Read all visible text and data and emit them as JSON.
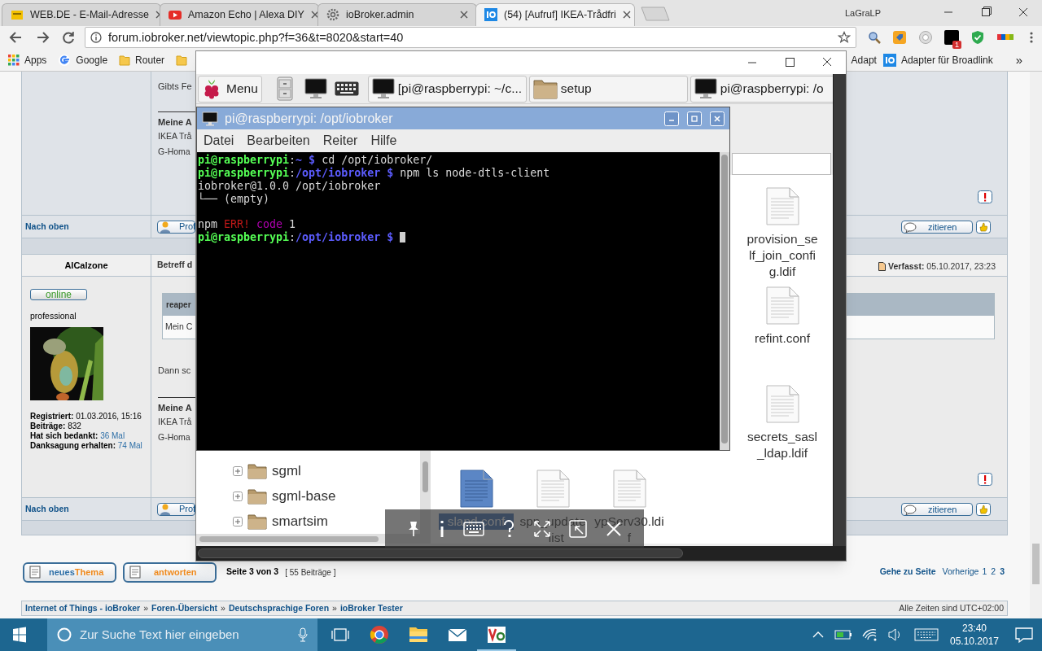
{
  "browser": {
    "tabs": [
      {
        "title": "WEB.DE - E-Mail-Adresse",
        "selected": false
      },
      {
        "title": "Amazon Echo | Alexa DIY",
        "selected": false
      },
      {
        "title": "ioBroker.admin",
        "selected": false
      },
      {
        "title": "(54) [Aufruf] IKEA-Trådfri",
        "selected": true
      }
    ],
    "profile": "LaGraLP",
    "url": "forum.iobroker.net/viewtopic.php?f=36&t=8020&start=40",
    "extension_badge": "1",
    "bookmarks_left": [
      {
        "kind": "apps",
        "label": "Apps"
      },
      {
        "kind": "site",
        "label": "Google"
      },
      {
        "kind": "folder",
        "label": "Router"
      }
    ],
    "bookmarks_right": [
      {
        "kind": "plain",
        "label": "Adapt"
      },
      {
        "kind": "site",
        "label": "Adapter für Broadlink"
      }
    ],
    "bookmarks_more": "»"
  },
  "forum": {
    "post_1": {
      "body": "Gibts Fe",
      "signature_title": "Meine A",
      "signature_lines": [
        "IKEA Trå",
        "G-Homa"
      ],
      "top_link": "Nach oben",
      "profile_button": "Prof",
      "quote_button": "zitieren"
    },
    "post_2": {
      "author": "AlCalzone",
      "subject": "Betreff d",
      "posted": "**Verfasst:** 05.10.2017, 23:23",
      "status": "online",
      "rank": "professional",
      "avatar": {
        "kind": "picture"
      },
      "stats": [
        {
          "label": "Registriert:",
          "value": "01.03.2016, 15:16",
          "link": false
        },
        {
          "label": "Beiträge:",
          "value": "832",
          "link": false
        },
        {
          "label": "Hat sich bedankt:",
          "value": "36 Mal",
          "link": true
        },
        {
          "label": "Danksagung erhalten:",
          "value": "74 Mal",
          "link": true
        }
      ],
      "quote": {
        "author": "reaper",
        "text": "Mein C"
      },
      "body": "Dann sc",
      "signature_title": "Meine A",
      "signature_lines": [
        "IKEA Trå",
        "G-Homa"
      ],
      "top_link": "Nach oben",
      "profile_button": "Prof",
      "quote_button": "zitieren"
    },
    "new_topic": [
      "neues",
      "Thema"
    ],
    "reply": "antworten",
    "page_info": "Seite 3 von 3",
    "post_count": "[ 55 Beiträge ]",
    "goto": "Gehe zu Seite",
    "previous": "Vorherige",
    "pages": [
      {
        "label": "1",
        "selected": false
      },
      {
        "label": "2",
        "selected": false
      },
      {
        "label": "3",
        "selected": true
      }
    ],
    "breadcrumb": [
      {
        "kind": "link",
        "text": "Internet of Things - ioBroker"
      },
      {
        "kind": "sep",
        "text": "»"
      },
      {
        "kind": "link",
        "text": "Foren-Übersicht"
      },
      {
        "kind": "sep",
        "text": "»"
      },
      {
        "kind": "link",
        "text": "Deutschsprachige Foren"
      },
      {
        "kind": "sep",
        "text": "»"
      },
      {
        "kind": "link",
        "text": "ioBroker Tester"
      }
    ],
    "timezone": "Alle Zeiten sind UTC+02:00"
  },
  "vnc": {
    "taskbar": {
      "menu": "Menu",
      "tasks": [
        {
          "kind": "terminal",
          "title": "[pi@raspberrypi: ~/c..."
        },
        {
          "kind": "folder",
          "title": "setup"
        },
        {
          "kind": "terminal",
          "title": "pi@raspberrypi: /o"
        }
      ]
    },
    "terminal": {
      "title": "pi@raspberrypi: /opt/iobroker",
      "menu": [
        "Datei",
        "Bearbeiten",
        "Reiter",
        "Hilfe"
      ],
      "lines": [
        {
          "gap_before": false,
          "cursor": false,
          "segments": [
            {
              "kind": "user",
              "text": "pi@raspberrypi"
            },
            {
              "kind": "text",
              "text": ":"
            },
            {
              "kind": "path",
              "text": "~ $"
            },
            {
              "kind": "text",
              "text": " cd /opt/iobroker/"
            }
          ]
        },
        {
          "gap_before": false,
          "cursor": false,
          "segments": [
            {
              "kind": "user",
              "text": "pi@raspberrypi"
            },
            {
              "kind": "text",
              "text": ":"
            },
            {
              "kind": "path",
              "text": "/opt/iobroker $"
            },
            {
              "kind": "text",
              "text": " npm ls node-dtls-client"
            }
          ]
        },
        {
          "gap_before": false,
          "cursor": false,
          "segments": [
            {
              "kind": "text",
              "text": "iobroker@1.0.0 /opt/iobroker"
            }
          ]
        },
        {
          "gap_before": false,
          "cursor": false,
          "segments": [
            {
              "kind": "text",
              "text": "└── (empty)"
            }
          ]
        },
        {
          "gap_before": true,
          "cursor": false,
          "segments": [
            {
              "kind": "text",
              "text": "npm "
            },
            {
              "kind": "error",
              "text": "ERR!"
            },
            {
              "kind": "warn",
              "text": " code"
            },
            {
              "kind": "text",
              "text": " 1"
            }
          ]
        },
        {
          "gap_before": false,
          "cursor": true,
          "segments": [
            {
              "kind": "user",
              "text": "pi@raspberrypi"
            },
            {
              "kind": "text",
              "text": ":"
            },
            {
              "kind": "path",
              "text": "/opt/iobroker $"
            }
          ]
        }
      ]
    },
    "file_manager": {
      "tree": [
        {
          "name": "sgml",
          "expanded": false
        },
        {
          "name": "sgml-base",
          "expanded": false
        },
        {
          "name": "smartsim",
          "expanded": false
        }
      ],
      "files": [
        {
          "name": "provision_self_join_config.ldif",
          "selected": false
        },
        {
          "name": "refint.conf",
          "selected": false
        },
        {
          "name": "secrets_sasl_ldap.ldif",
          "selected": false
        },
        {
          "name": "slapd.conf",
          "selected": true
        },
        {
          "name": "spn_update_list",
          "selected": false
        },
        {
          "name": "ypServ30.ldif",
          "selected": false
        }
      ]
    }
  },
  "taskbar": {
    "search_placeholder": "Zur Suche Text hier eingeben",
    "apps": [
      {
        "kind": "browser",
        "open": false
      },
      {
        "kind": "folder",
        "open": false
      },
      {
        "kind": "mail",
        "open": false
      },
      {
        "kind": "viewer",
        "open": true
      }
    ],
    "time": "23:40",
    "date": "05.10.2017"
  }
}
